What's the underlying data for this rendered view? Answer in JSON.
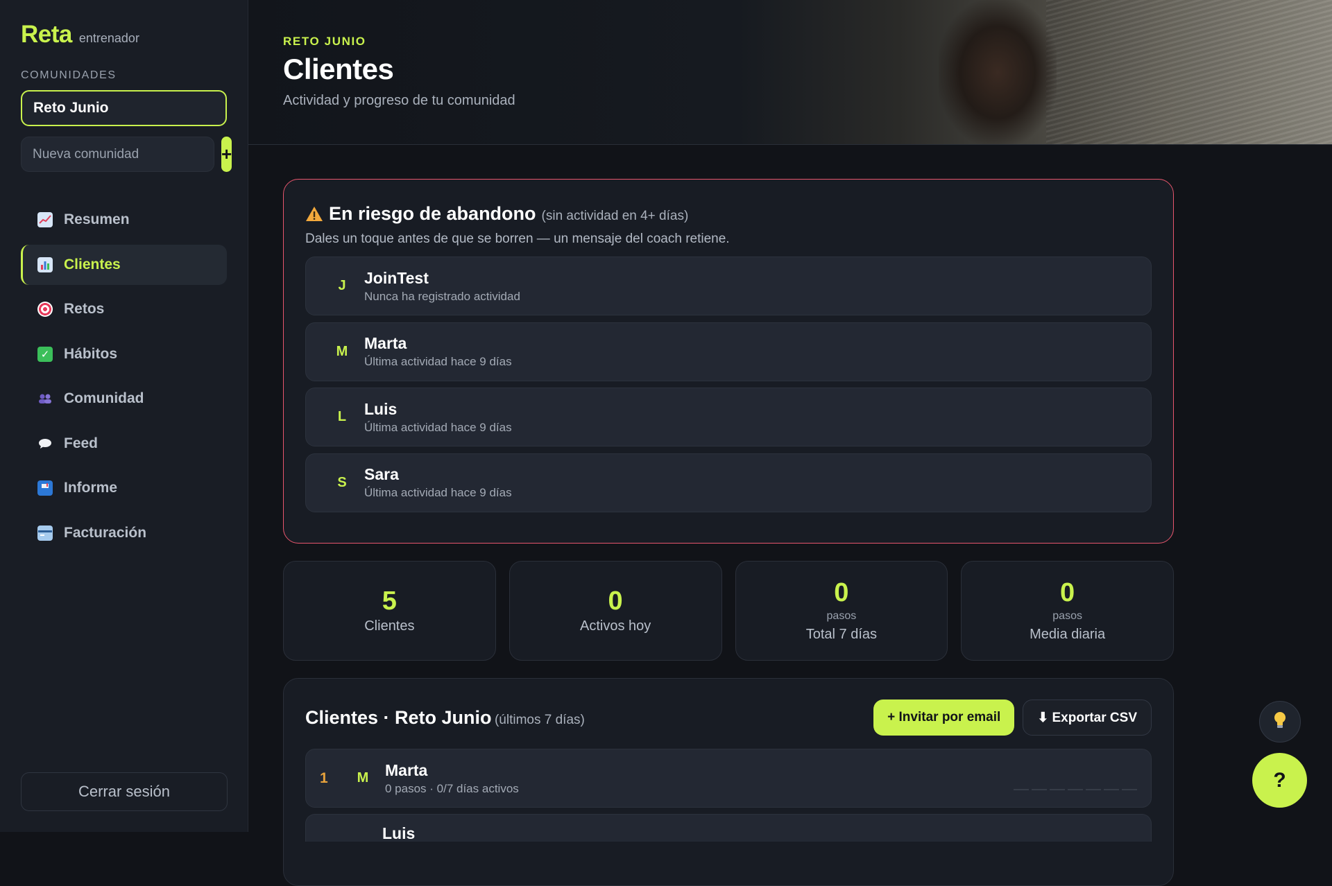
{
  "brand": {
    "name": "Reta",
    "role": "entrenador"
  },
  "sidebar": {
    "section_label": "COMUNIDADES",
    "selected_community": "Reto Junio",
    "new_community_placeholder": "Nueva comunidad",
    "add_label": "+",
    "nav": [
      {
        "label": "Resumen",
        "icon": "chart-increasing-icon"
      },
      {
        "label": "Clientes",
        "icon": "bar-chart-icon",
        "active": true
      },
      {
        "label": "Retos",
        "icon": "target-icon"
      },
      {
        "label": "Hábitos",
        "icon": "check-box-icon"
      },
      {
        "label": "Comunidad",
        "icon": "people-icon"
      },
      {
        "label": "Feed",
        "icon": "speech-bubble-icon"
      },
      {
        "label": "Informe",
        "icon": "mailbox-icon"
      },
      {
        "label": "Facturación",
        "icon": "credit-card-icon"
      }
    ],
    "logout_label": "Cerrar sesión"
  },
  "header": {
    "eyebrow": "RETO JUNIO",
    "title": "Clientes",
    "subtitle": "Actividad y progreso de tu comunidad"
  },
  "risk": {
    "title": "En riesgo de abandono",
    "note": "(sin actividad en 4+ días)",
    "description": "Dales un toque antes de que se borren — un mensaje del coach retiene.",
    "items": [
      {
        "initial": "J",
        "name": "JoinTest",
        "meta": "Nunca ha registrado actividad"
      },
      {
        "initial": "M",
        "name": "Marta",
        "meta": "Última actividad hace 9 días"
      },
      {
        "initial": "L",
        "name": "Luis",
        "meta": "Última actividad hace 9 días"
      },
      {
        "initial": "S",
        "name": "Sara",
        "meta": "Última actividad hace 9 días"
      }
    ]
  },
  "stats": [
    {
      "value": "5",
      "unit": "",
      "label": "Clientes"
    },
    {
      "value": "0",
      "unit": "",
      "label": "Activos hoy"
    },
    {
      "value": "0",
      "unit": "pasos",
      "label": "Total 7 días"
    },
    {
      "value": "0",
      "unit": "pasos",
      "label": "Media diaria"
    }
  ],
  "clients": {
    "title": "Clientes · Reto Junio",
    "note": "(últimos 7 días)",
    "invite_label": "+ Invitar por email",
    "export_label": "⬇ Exportar CSV",
    "rows": [
      {
        "rank": "1",
        "initial": "M",
        "name": "Marta",
        "meta": "0 pasos · 0/7 días activos"
      },
      {
        "name": "Luis"
      }
    ]
  },
  "fab": {
    "tip_icon": "light-bulb-icon",
    "help_label": "?"
  },
  "colors": {
    "accent": "#c9f24d",
    "danger": "#e8566d",
    "rank": "#e8a33c",
    "background": "#111318"
  }
}
